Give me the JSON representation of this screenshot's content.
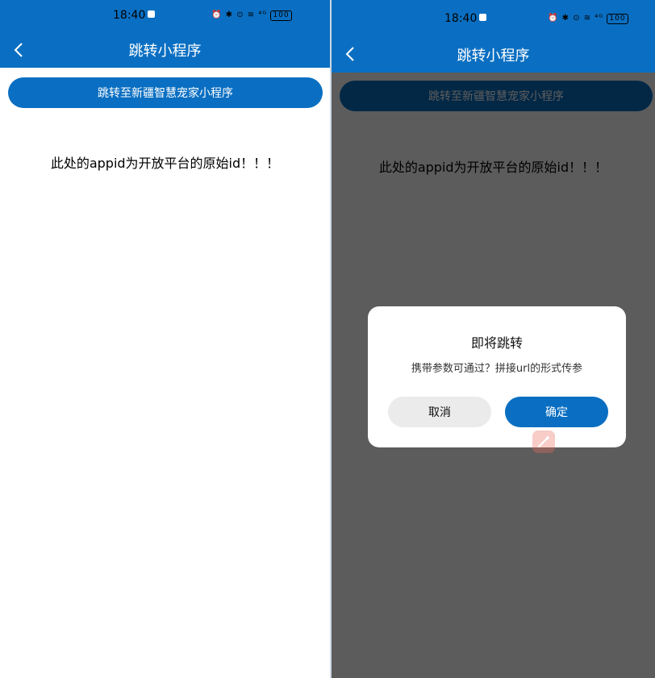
{
  "status_bar": {
    "time": "18:40",
    "icons_text": "⏰ ✱ ⊙ ≋ ⁴ᴳ",
    "battery": "100"
  },
  "header": {
    "title": "跳转小程序"
  },
  "main": {
    "jump_button_label": "跳转至新疆智慧宠家小程序",
    "note_text": "此处的appid为开放平台的原始id！！！"
  },
  "dialog": {
    "title": "即将跳转",
    "message": "携带参数可通过？拼接url的形式传参",
    "cancel_label": "取消",
    "confirm_label": "确定"
  },
  "colors": {
    "primary": "#0a6fc2",
    "overlay": "rgba(0,0,0,0.64)",
    "cancel_bg": "#ebebeb"
  }
}
